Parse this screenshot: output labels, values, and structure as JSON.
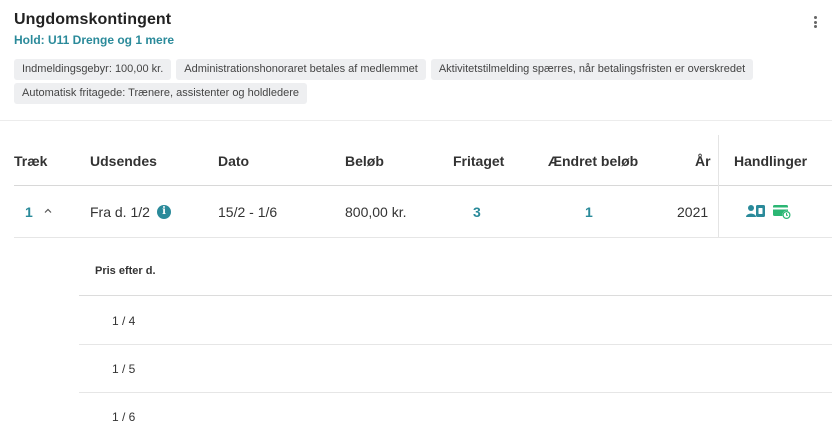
{
  "header": {
    "title": "Ungdomskontingent",
    "subtitle": "Hold: U11 Drenge og 1 mere"
  },
  "tags": [
    "Indmeldingsgebyr: 100,00 kr.",
    "Administrationshonoraret betales af medlemmet",
    "Aktivitetstilmelding spærres, når betalingsfristen er overskredet",
    "Automatisk fritagede: Trænere, assistenter og holdledere"
  ],
  "table": {
    "columns": {
      "traek": "Træk",
      "udsendes": "Udsendes",
      "dato": "Dato",
      "beloeb": "Beløb",
      "fritaget": "Fritaget",
      "aendret": "Ændret beløb",
      "aar": "År",
      "handlinger": "Handlinger"
    },
    "rows": [
      {
        "traek": "1",
        "udsendes": "Fra d. 1/2",
        "dato": "15/2 - 1/6",
        "beloeb": "800,00 kr.",
        "fritaget": "3",
        "aendret": "1",
        "aar": "2021"
      }
    ]
  },
  "subtable": {
    "header": "Pris efter d.",
    "rows": [
      "1 / 4",
      "1 / 5",
      "1 / 6"
    ]
  },
  "icons": {
    "info": "i",
    "expand": "chevron-up-icon",
    "action_member": "member-card-icon",
    "action_payment": "card-clock-icon"
  },
  "colors": {
    "accent": "#2a8a9a",
    "action_green": "#2bb673"
  }
}
